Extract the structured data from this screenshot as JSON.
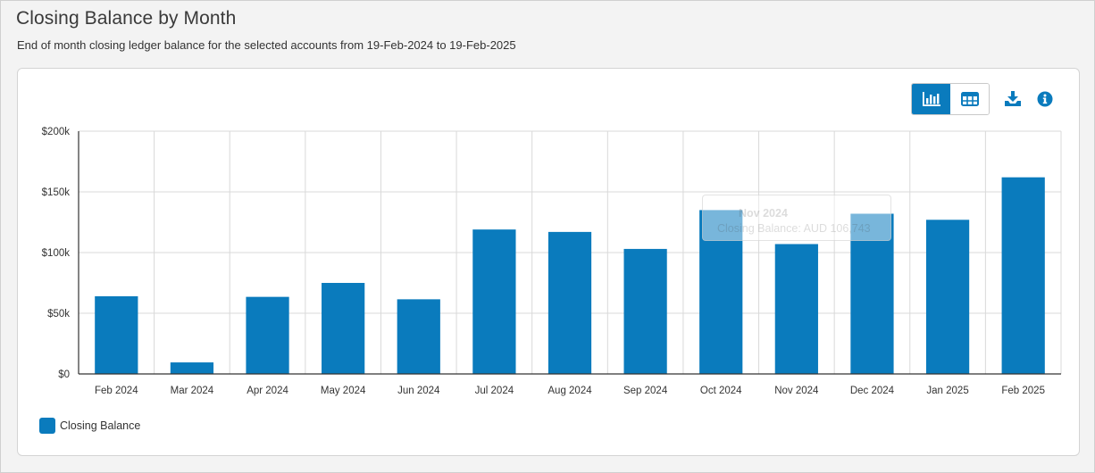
{
  "header": {
    "title": "Closing Balance by Month",
    "subtitle": "End of month closing ledger balance for the selected accounts from 19-Feb-2024 to 19-Feb-2025"
  },
  "toolbar": {
    "chart_view_icon": "bar-chart-icon",
    "table_view_icon": "table-grid-icon",
    "download_icon": "download-icon",
    "info_icon": "info-icon",
    "active_view": "chart"
  },
  "tooltip": {
    "title": "Nov 2024",
    "body": "Closing Balance: AUD 106,743"
  },
  "colors": {
    "bar": "#0a7bbd",
    "accent": "#0a7bbd",
    "grid": "#d9d9d9"
  },
  "chart_data": {
    "type": "bar",
    "title": "",
    "xlabel": "",
    "ylabel": "",
    "categories": [
      "Feb 2024",
      "Mar 2024",
      "Apr 2024",
      "May 2024",
      "Jun 2024",
      "Jul 2024",
      "Aug 2024",
      "Sep 2024",
      "Oct 2024",
      "Nov 2024",
      "Dec 2024",
      "Jan 2025",
      "Feb 2025"
    ],
    "series": [
      {
        "name": "Closing Balance",
        "values": [
          64000,
          9500,
          63500,
          75000,
          61500,
          119000,
          117000,
          103000,
          135000,
          107000,
          132000,
          127000,
          162000
        ]
      }
    ],
    "ylim": [
      0,
      200000
    ],
    "yticks": [
      0,
      50000,
      100000,
      150000,
      200000
    ],
    "ytick_labels": [
      "$0",
      "$50k",
      "$100k",
      "$150k",
      "$200k"
    ],
    "grid": true,
    "legend": "bottom-left"
  }
}
